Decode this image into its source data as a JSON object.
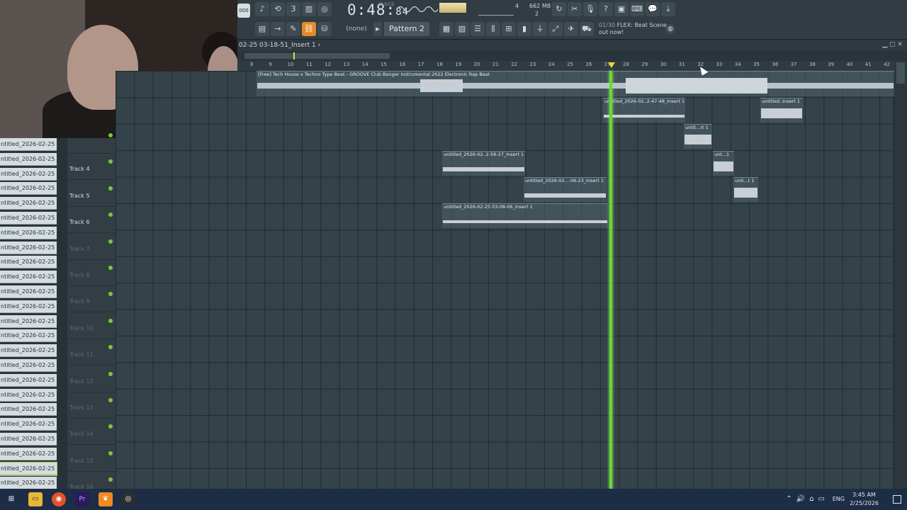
{
  "toolbar": {
    "tempo_label": "000",
    "time": "0:48",
    "time_fraction": "84",
    "time_unit": "M:S:CS",
    "cpu": "4",
    "cpu_poly": "2",
    "memory": "662 MB",
    "pattern_name": "Pattern 2",
    "snap": "(none)",
    "hint_count": "01/30",
    "hint_text": "FLEX: Beat Scene out now!"
  },
  "playlist": {
    "title": "02-25 03-18-51_Insert 1",
    "title_arrow": "›",
    "ruler_ticks": [
      "8",
      "9",
      "10",
      "11",
      "12",
      "13",
      "14",
      "15",
      "16",
      "17",
      "18",
      "19",
      "20",
      "21",
      "22",
      "23",
      "24",
      "25",
      "26",
      "27",
      "28",
      "29",
      "30",
      "31",
      "32",
      "33",
      "34",
      "35",
      "36",
      "37",
      "38",
      "39",
      "40",
      "41",
      "42"
    ]
  },
  "clip_list": [
    "ntitled_2026-02-25 03-...",
    "ntitled_2026-02-25 03-...",
    "ntitled_2026-02-25 03-...",
    "ntitled_2026-02-25 03-...",
    "ntitled_2026-02-25 03-...",
    "ntitled_2026-02-25 03-...",
    "ntitled_2026-02-25 03-...",
    "ntitled_2026-02-25 03-...",
    "ntitled_2026-02-25 03-...",
    "ntitled_2026-02-25 03-...",
    "ntitled_2026-02-25 03-...",
    "ntitled_2026-02-25 03-...",
    "ntitled_2026-02-25 03-...",
    "ntitled_2026-02-25 03-...",
    "ntitled_2026-02-25 03-...",
    "ntitled_2026-02-25 03-...",
    "ntitled_2026-02-25 03-...",
    "ntitled_2026-02-25 03-...",
    "ntitled_2026-02-25 03-...",
    "ntitled_2026-02-25 03-...",
    "ntitled_2026-02-25 03-...",
    "ntitled_2026-02-25 03-...",
    "ntitled_2026-02-25 03-...",
    "ntitled_2026-02-25 03-..."
  ],
  "tracks": [
    {
      "label": "",
      "dim": false
    },
    {
      "label": "Track 4",
      "dim": false
    },
    {
      "label": "Track 5",
      "dim": false
    },
    {
      "label": "Track 6",
      "dim": false
    },
    {
      "label": "Track 7",
      "dim": true
    },
    {
      "label": "Track 8",
      "dim": true
    },
    {
      "label": "Track 9",
      "dim": true
    },
    {
      "label": "Track 10",
      "dim": true
    },
    {
      "label": "Track 11",
      "dim": true
    },
    {
      "label": "Track 12",
      "dim": true
    },
    {
      "label": "Track 13",
      "dim": true
    },
    {
      "label": "Track 14",
      "dim": true
    },
    {
      "label": "Track 15",
      "dim": true
    },
    {
      "label": "Track 16",
      "dim": true
    }
  ],
  "clips": {
    "beat": "[Free] Tech House x Techno Type Beat - GROOVE  Club Banger Instrumental 2022  Electronic Rap Beat",
    "c1": "untitled_2026-02..2-47-48_Insert 1",
    "c2": "untitled..Insert 1",
    "c3": "untit...rt 1",
    "c4": "untitled_2026-02..2-56-27_Insert 1",
    "c5": "unt...1",
    "c6": "untitled_2026-02...-06-23_Insert 1",
    "c7": "unti...t 1",
    "c8": "untitled_2026-02-25 03-08-06_Insert 1"
  },
  "taskbar": {
    "language": "ENG",
    "time": "3:45 AM",
    "date": "2/25/2026",
    "apps": [
      "windows-start",
      "file-explorer",
      "firefox",
      "premiere-pro",
      "fl-studio",
      "obs"
    ]
  },
  "colors": {
    "accent": "#e28a2b",
    "playhead": "#6ed43a",
    "led": "#7cc63a"
  }
}
